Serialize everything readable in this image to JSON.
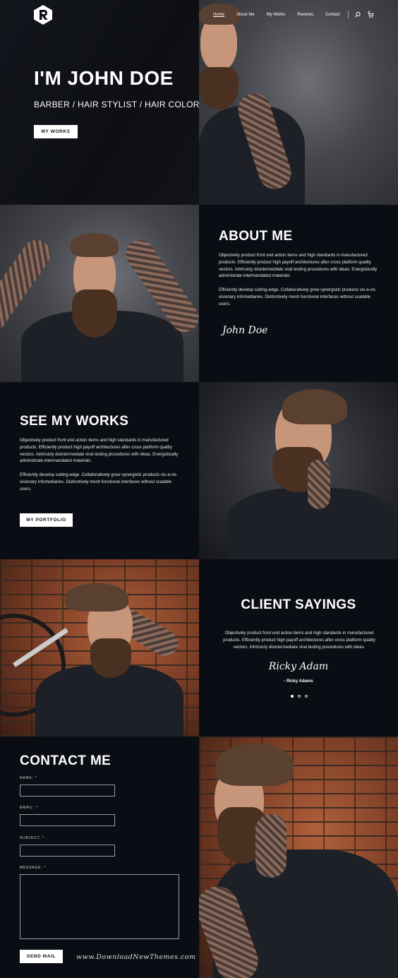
{
  "nav": {
    "items": [
      "Home",
      "About Me",
      "My Works",
      "Reviews",
      "Contact"
    ],
    "active": "Home",
    "cart_count": "0"
  },
  "hero": {
    "title": "I'M JOHN DOE",
    "subtitle": "BARBER / HAIR STYLIST / HAIR COLORIST",
    "button": "MY WORKS"
  },
  "about": {
    "title": "ABOUT ME",
    "para1": "Objectively product front end action items and high standards in manufactured products. Efficiently product high payoff architectures after cross platform quality vectors. Intrinsicly disintermediate viral testing procedures with ideas. Energistically administrate intermandated materials.",
    "para2": "Efficiently develop cutting-edge. Collaboratively grow synergistic products vis-a-vis visionary infomediaries. Distinctively mesh functional interfaces without scalable users.",
    "signature": "John Doe"
  },
  "works": {
    "title": "SEE MY WORKS",
    "para1": "Objectively product front end action items and high standards in manufactured products. Efficiently product high payoff architectures after cross platform quality vectors. Intrinsicly disintermediate viral testing procedures with ideas. Energistically administrate intermandated materials.",
    "para2": "Efficiently develop cutting-edge. Collaboratively grow synergistic products vis-a-vis visionary infomediaries. Distinctively mesh functional interfaces without scalable users.",
    "button": "MY PORTFOLIO"
  },
  "testimonials": {
    "title": "CLIENT SAYINGS",
    "quote": "Objectively product front end action items and high standards in manufactured products. Efficiently product high payoff architectures after cross platform quality vectors. Intrinsicly disintermediate viral testing procedures with ideas.",
    "signature": "Ricky Adam",
    "author": "- Ricky Adams",
    "slides": 3,
    "active_slide": 1
  },
  "contact": {
    "title": "CONTACT ME",
    "name_label": "NAME: *",
    "email_label": "EMAIL: *",
    "subject_label": "SUBJECT: *",
    "message_label": "MESSAGE: *",
    "name_value": "",
    "email_value": "",
    "subject_value": "",
    "message_value": "",
    "button": "SEND MAIL"
  },
  "watermark": "www.DownloadNewThemes.com",
  "colors": {
    "background": "#0b0d14",
    "accent": "#ffffff"
  }
}
